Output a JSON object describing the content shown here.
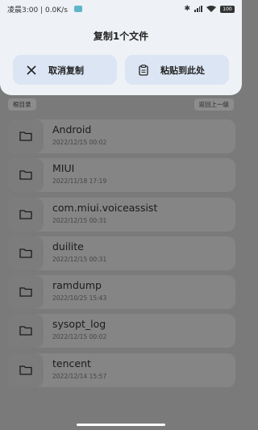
{
  "status_bar": {
    "left_text": "凌晨3:00 | 0.0K/s",
    "battery": "100"
  },
  "dialog": {
    "title": "复制1个文件",
    "cancel_label": "取消复制",
    "paste_label": "粘贴到此处"
  },
  "path": {
    "root_label": "根目录",
    "up_label": "返回上一级"
  },
  "files": [
    {
      "name": "Android",
      "date": "2022/12/15 00:02"
    },
    {
      "name": "MIUI",
      "date": "2022/11/18 17:19"
    },
    {
      "name": "com.miui.voiceassist",
      "date": "2022/12/15 00:31"
    },
    {
      "name": "duilite",
      "date": "2022/12/15 00:31"
    },
    {
      "name": "ramdump",
      "date": "2022/10/25 15:43"
    },
    {
      "name": "sysopt_log",
      "date": "2022/12/15 00:02"
    },
    {
      "name": "tencent",
      "date": "2022/12/14 15:57"
    }
  ],
  "icons": {
    "folder": "folder-icon",
    "close": "close-icon",
    "paste": "clipboard-icon"
  }
}
